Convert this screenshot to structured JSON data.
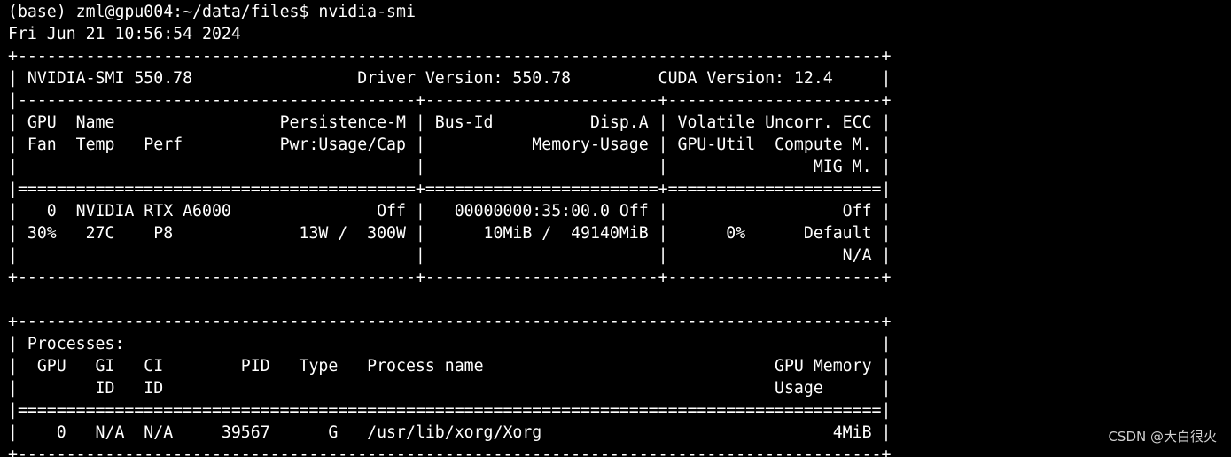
{
  "terminal": {
    "prompt": "(base) zml@gpu004:~/data/files$ nvidia-smi",
    "timestamp": "Fri Jun 21 10:56:54 2024",
    "gpu_table": [
      "+-----------------------------------------------------------------------------------------+",
      "| NVIDIA-SMI 550.78                 Driver Version: 550.78         CUDA Version: 12.4     |",
      "|-----------------------------------------+------------------------+----------------------+",
      "| GPU  Name                 Persistence-M | Bus-Id          Disp.A | Volatile Uncorr. ECC |",
      "| Fan  Temp   Perf          Pwr:Usage/Cap |           Memory-Usage | GPU-Util  Compute M. |",
      "|                                         |                        |               MIG M. |",
      "|=========================================+========================+======================|",
      "|   0  NVIDIA RTX A6000               Off |   00000000:35:00.0 Off |                  Off |",
      "| 30%   27C    P8             13W /  300W |      10MiB /  49140MiB |      0%      Default |",
      "|                                         |                        |                  N/A |",
      "+-----------------------------------------+------------------------+----------------------+"
    ],
    "process_table": [
      "+-----------------------------------------------------------------------------------------+",
      "| Processes:                                                                              |",
      "|  GPU   GI   CI        PID   Type   Process name                              GPU Memory |",
      "|        ID   ID                                                               Usage      |",
      "|=========================================================================================|",
      "|    0   N/A  N/A     39567      G   /usr/lib/xorg/Xorg                              4MiB |",
      "+-----------------------------------------------------------------------------------------+"
    ]
  },
  "watermark": "CSDN @大白很火"
}
